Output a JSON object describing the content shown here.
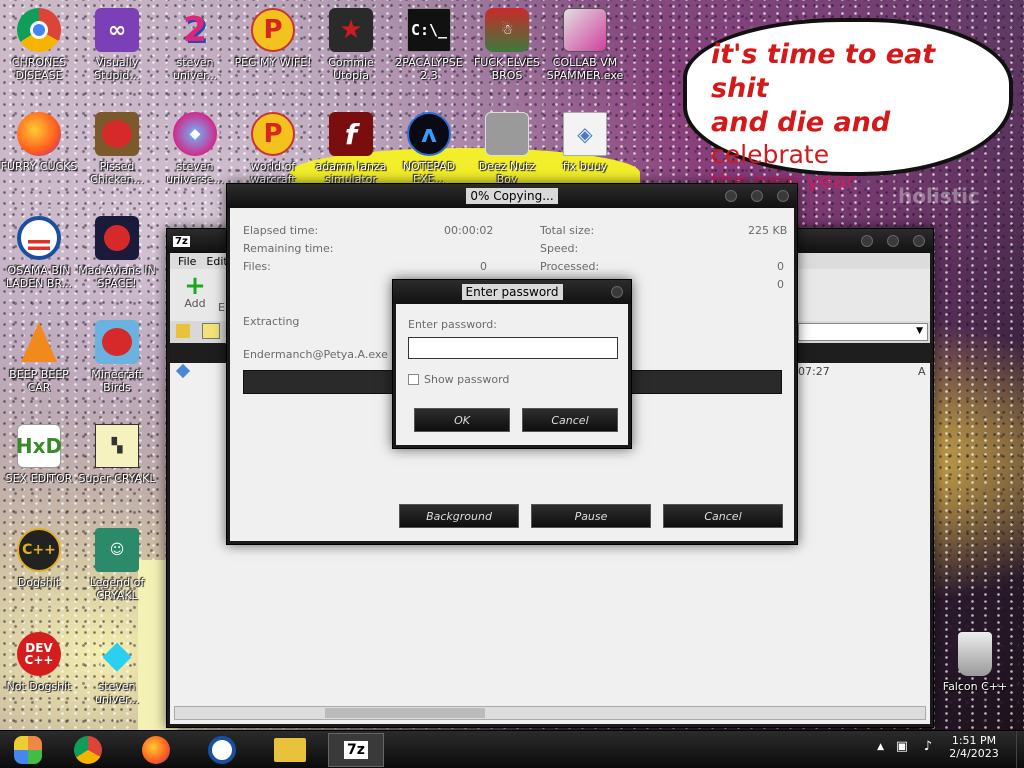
{
  "desktop": {
    "icons": [
      {
        "label": "CHRONES DISEASE"
      },
      {
        "label": "Visually Stupid..."
      },
      {
        "label": "steven univer..."
      },
      {
        "label": "PEG MY WIFE!"
      },
      {
        "label": "Commie Utopia"
      },
      {
        "label": "2PACALYPSE 2.3"
      },
      {
        "label": "FUCK ELVES BROS"
      },
      {
        "label": "COLLAB VM SPAMMER.exe"
      },
      {
        "label": "FURRY CUCKS"
      },
      {
        "label": "Pissed Chicken..."
      },
      {
        "label": "steven universe..."
      },
      {
        "label": "world of warcraft"
      },
      {
        "label": "adamn lanza simulator"
      },
      {
        "label": "NOTEPAD EXE..."
      },
      {
        "label": "Deez Nutz Boy"
      },
      {
        "label": "fix buuy"
      },
      {
        "label": "OSAMA BIN LADEN BR..."
      },
      {
        "label": "Mad Avians IN SPACE!"
      },
      {
        "label": "BEEP BEEP CAR"
      },
      {
        "label": "Minecraft Birds"
      },
      {
        "label": "SEX EDITOR"
      },
      {
        "label": "Super CRYAKL"
      },
      {
        "label": "Dogshit"
      },
      {
        "label": "Legend of CRYAKL"
      },
      {
        "label": "Not Dogshit"
      },
      {
        "label": "steven univer..."
      },
      {
        "label": "Falcon C++"
      }
    ],
    "bubble": {
      "line1": "it's time to eat shit",
      "line2_bold": "and die and",
      "line2_plain": " celebrate",
      "line3": "the new year"
    }
  },
  "sevenzip_window": {
    "menu": [
      "File",
      "Edit"
    ],
    "toolbar_add": "Add",
    "toolbar_extract": "E",
    "row_time": "07:27",
    "row_attr": "A"
  },
  "copy_dialog": {
    "title": "0% Copying...",
    "elapsed_label": "Elapsed time:",
    "elapsed_value": "00:00:02",
    "remaining_label": "Remaining time:",
    "files_label": "Files:",
    "files_value": "0",
    "total_size_label": "Total size:",
    "total_size_value": "225 KB",
    "speed_label": "Speed:",
    "processed_label": "Processed:",
    "processed_value": "0",
    "extra_value": "0",
    "status": "Extracting",
    "filename": "Endermanch@Petya.A.exe",
    "btn_background": "Background",
    "btn_pause": "Pause",
    "btn_cancel": "Cancel"
  },
  "password_dialog": {
    "title": "Enter password",
    "prompt": "Enter password:",
    "input_value": "",
    "show_password": "Show password",
    "ok": "OK",
    "cancel": "Cancel"
  },
  "taskbar": {
    "time": "1:51 PM",
    "date": "2/4/2023",
    "apps": [
      "start-icon",
      "chrome-icon",
      "firefox-icon",
      "obama-icon",
      "file-explorer-icon",
      "sevenzip-icon"
    ]
  }
}
